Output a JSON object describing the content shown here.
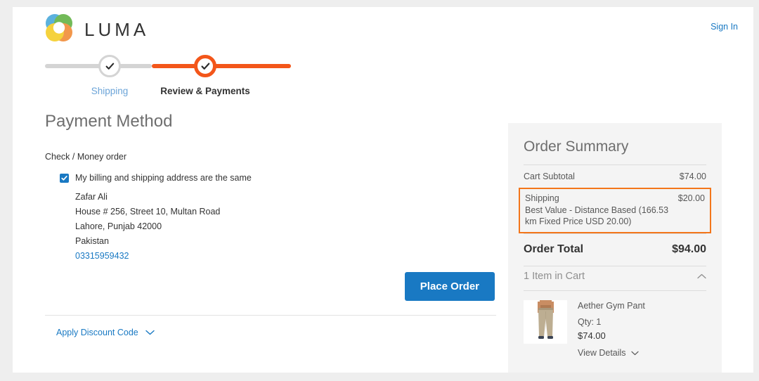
{
  "brand": {
    "name": "LUMA",
    "logo_colors": {
      "blue": "#3fa4d8",
      "green": "#5aaf3c",
      "orange": "#f0852c",
      "yellow": "#f4cb1c"
    }
  },
  "header": {
    "sign_in_label": "Sign In"
  },
  "progress": {
    "steps": [
      {
        "label": "Shipping",
        "state": "completed",
        "icon": "check-icon"
      },
      {
        "label": "Review & Payments",
        "state": "active",
        "icon": "check-icon"
      }
    ],
    "track_color_done": "#d4d4d4",
    "track_color_active": "#f3561a"
  },
  "payment": {
    "section_title": "Payment Method",
    "method_label": "Check / Money order",
    "billing_checkbox_label": "My billing and shipping address are the same",
    "billing_checkbox_checked": true,
    "address": {
      "name": "Zafar Ali",
      "street": "House # 256, Street 10, Multan Road",
      "city_region_zip": "Lahore, Punjab 42000",
      "country": "Pakistan",
      "phone": "03315959432"
    },
    "place_order_label": "Place Order",
    "discount_label": "Apply Discount Code",
    "discount_icon": "chevron-down-icon"
  },
  "summary": {
    "title": "Order Summary",
    "rows": [
      {
        "label": "Cart Subtotal",
        "value": "$74.00"
      }
    ],
    "shipping": {
      "label": "Shipping",
      "value": "$20.00",
      "description": "Best Value - Distance Based (166.53 km Fixed Price USD 20.00)",
      "highlight_color": "#f3761a"
    },
    "total": {
      "label": "Order Total",
      "value": "$94.00"
    },
    "cart_toggle": {
      "label": "1 Item in Cart",
      "icon": "chevron-up-icon"
    },
    "items": [
      {
        "name": "Aether Gym Pant",
        "qty_label": "Qty: 1",
        "price": "$74.00",
        "view_details_label": "View Details",
        "view_details_icon": "chevron-down-icon",
        "thumb_alt": "aether-gym-pant-thumbnail"
      }
    ]
  },
  "colors": {
    "accent_blue": "#1979c3",
    "accent_orange": "#f3561a",
    "panel_gray": "#f4f4f4",
    "text_dark": "#333333",
    "text_muted": "#575757"
  }
}
